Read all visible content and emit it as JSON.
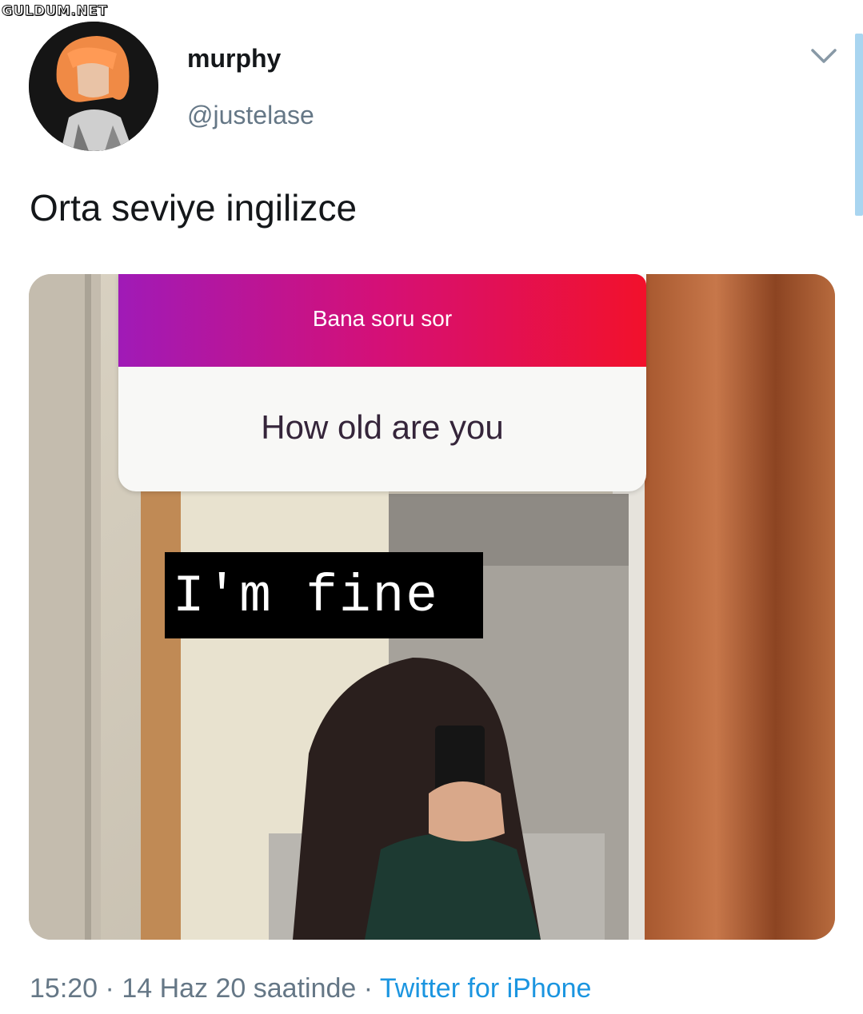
{
  "watermark": "GULDUM.NET",
  "user": {
    "display_name": "murphy",
    "handle": "@justelase"
  },
  "tweet": {
    "text": "Orta seviye ingilizce"
  },
  "media": {
    "question_header": "Bana soru sor",
    "question": "How old are you",
    "answer": "I'm fine"
  },
  "footer": {
    "time": "15:20",
    "separator": " · ",
    "date": "14 Haz 20 saatinde",
    "source": "Twitter for iPhone"
  },
  "icons": {
    "menu": "chevron-down-icon"
  },
  "colors": {
    "link": "#1b95e0",
    "muted": "#657786",
    "gradient_start": "#a01ab7",
    "gradient_end": "#f2112b"
  }
}
